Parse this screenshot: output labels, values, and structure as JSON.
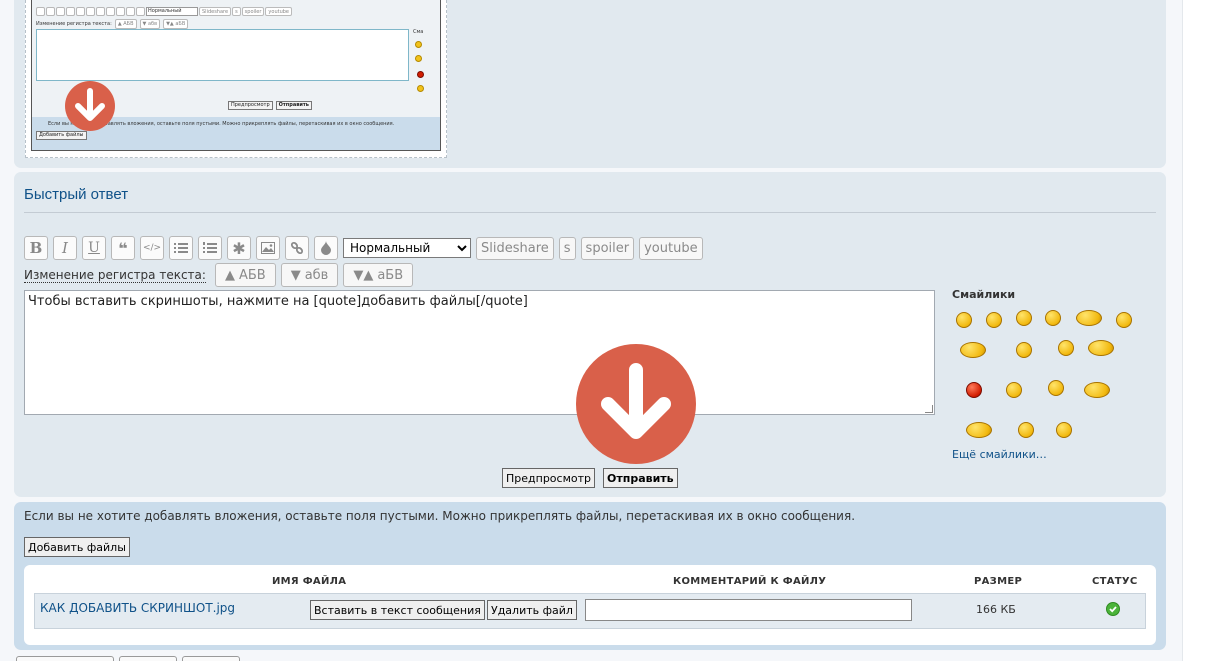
{
  "mini_screenshot": {
    "size_option": "Нормальный",
    "toolbar_text_buttons": [
      "Slideshare",
      "s",
      "spoiler",
      "youtube"
    ],
    "case_label": "Изменение регистра текста:",
    "case_buttons": [
      "▲ АБВ",
      "▼ абв",
      "▼▲ аБВ"
    ],
    "smilies_label": "Сма",
    "preview_label": "Предпросмотр",
    "submit_label": "Отправить",
    "attach_note": "Если вы не хотите добавлять вложения, оставьте поля пустыми. Можно прикреплять файлы, перетаскивая их в окно сообщения.",
    "add_files_label": "Добавить файлы"
  },
  "quick_reply": {
    "title": "Быстрый ответ",
    "font_size_select": {
      "selected": "Нормальный"
    },
    "toolbar_text_buttons": [
      "Slideshare",
      "s",
      "spoiler",
      "youtube"
    ],
    "case": {
      "label": "Изменение регистра текста:",
      "buttons": [
        {
          "arrow": "▲",
          "text": "АБВ"
        },
        {
          "arrow": "▼",
          "text": "абв"
        },
        {
          "arrow": "▼▲",
          "text": "аБВ"
        }
      ]
    },
    "message_value": "Чтобы вставить скриншоты, нажмите на [quote]добавить файлы[/quote]",
    "smilies_title": "Смайлики",
    "more_smilies": "Ещё смайлики…",
    "preview_label": "Предпросмотр",
    "submit_label": "Отправить"
  },
  "attachments": {
    "note": "Если вы не хотите добавлять вложения, оставьте поля пустыми. Можно прикреплять файлы, перетаскивая их в окно сообщения.",
    "add_files_label": "Добавить файлы",
    "columns": {
      "filename": "ИМЯ ФАЙЛА",
      "comment": "КОММЕНТАРИЙ К ФАЙЛУ",
      "size": "РАЗМЕР",
      "status": "СТАТУС"
    },
    "rows": [
      {
        "filename": "КАК ДОБАВИТЬ СКРИНШОТ.jpg",
        "insert_label": "Вставить в текст сообщения",
        "delete_label": "Удалить файл",
        "comment": "",
        "size": "166 КБ",
        "status": "ok"
      }
    ]
  },
  "colors": {
    "accent_arrow": "#d9604a",
    "link": "#105289",
    "panel": "#e1e9ef",
    "panel_alt": "#cadceb",
    "status_ok": "#4bb33a"
  },
  "icons": [
    "bold-icon",
    "italic-icon",
    "underline-icon",
    "quote-icon",
    "code-icon",
    "list-icon",
    "numbered-list-icon",
    "asterisk-icon",
    "image-icon",
    "link-icon",
    "color-drop-icon",
    "down-arrow-icon",
    "check-icon"
  ]
}
